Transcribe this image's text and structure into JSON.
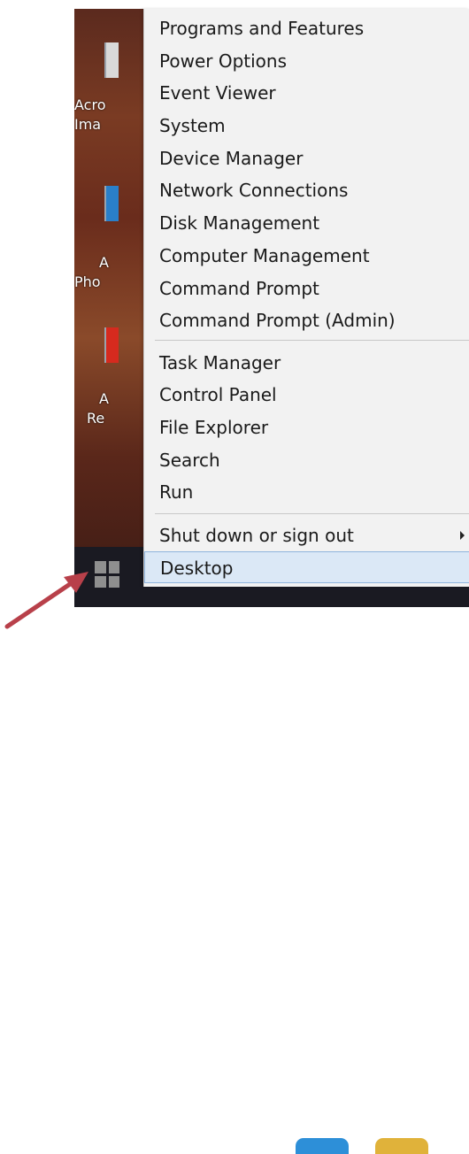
{
  "desktop": {
    "labels": [
      "Acro",
      "Ima",
      "A",
      "Pho",
      "A",
      "Re"
    ]
  },
  "menu": {
    "group1": [
      "Programs and Features",
      "Power Options",
      "Event Viewer",
      "System",
      "Device Manager",
      "Network Connections",
      "Disk Management",
      "Computer Management",
      "Command Prompt",
      "Command Prompt (Admin)"
    ],
    "group2": [
      "Task Manager",
      "Control Panel",
      "File Explorer",
      "Search",
      "Run"
    ],
    "group3": [
      "Shut down or sign out",
      "Desktop"
    ]
  },
  "colors": {
    "highlight": "#dbe8f6",
    "arrow": "#b8404a"
  }
}
